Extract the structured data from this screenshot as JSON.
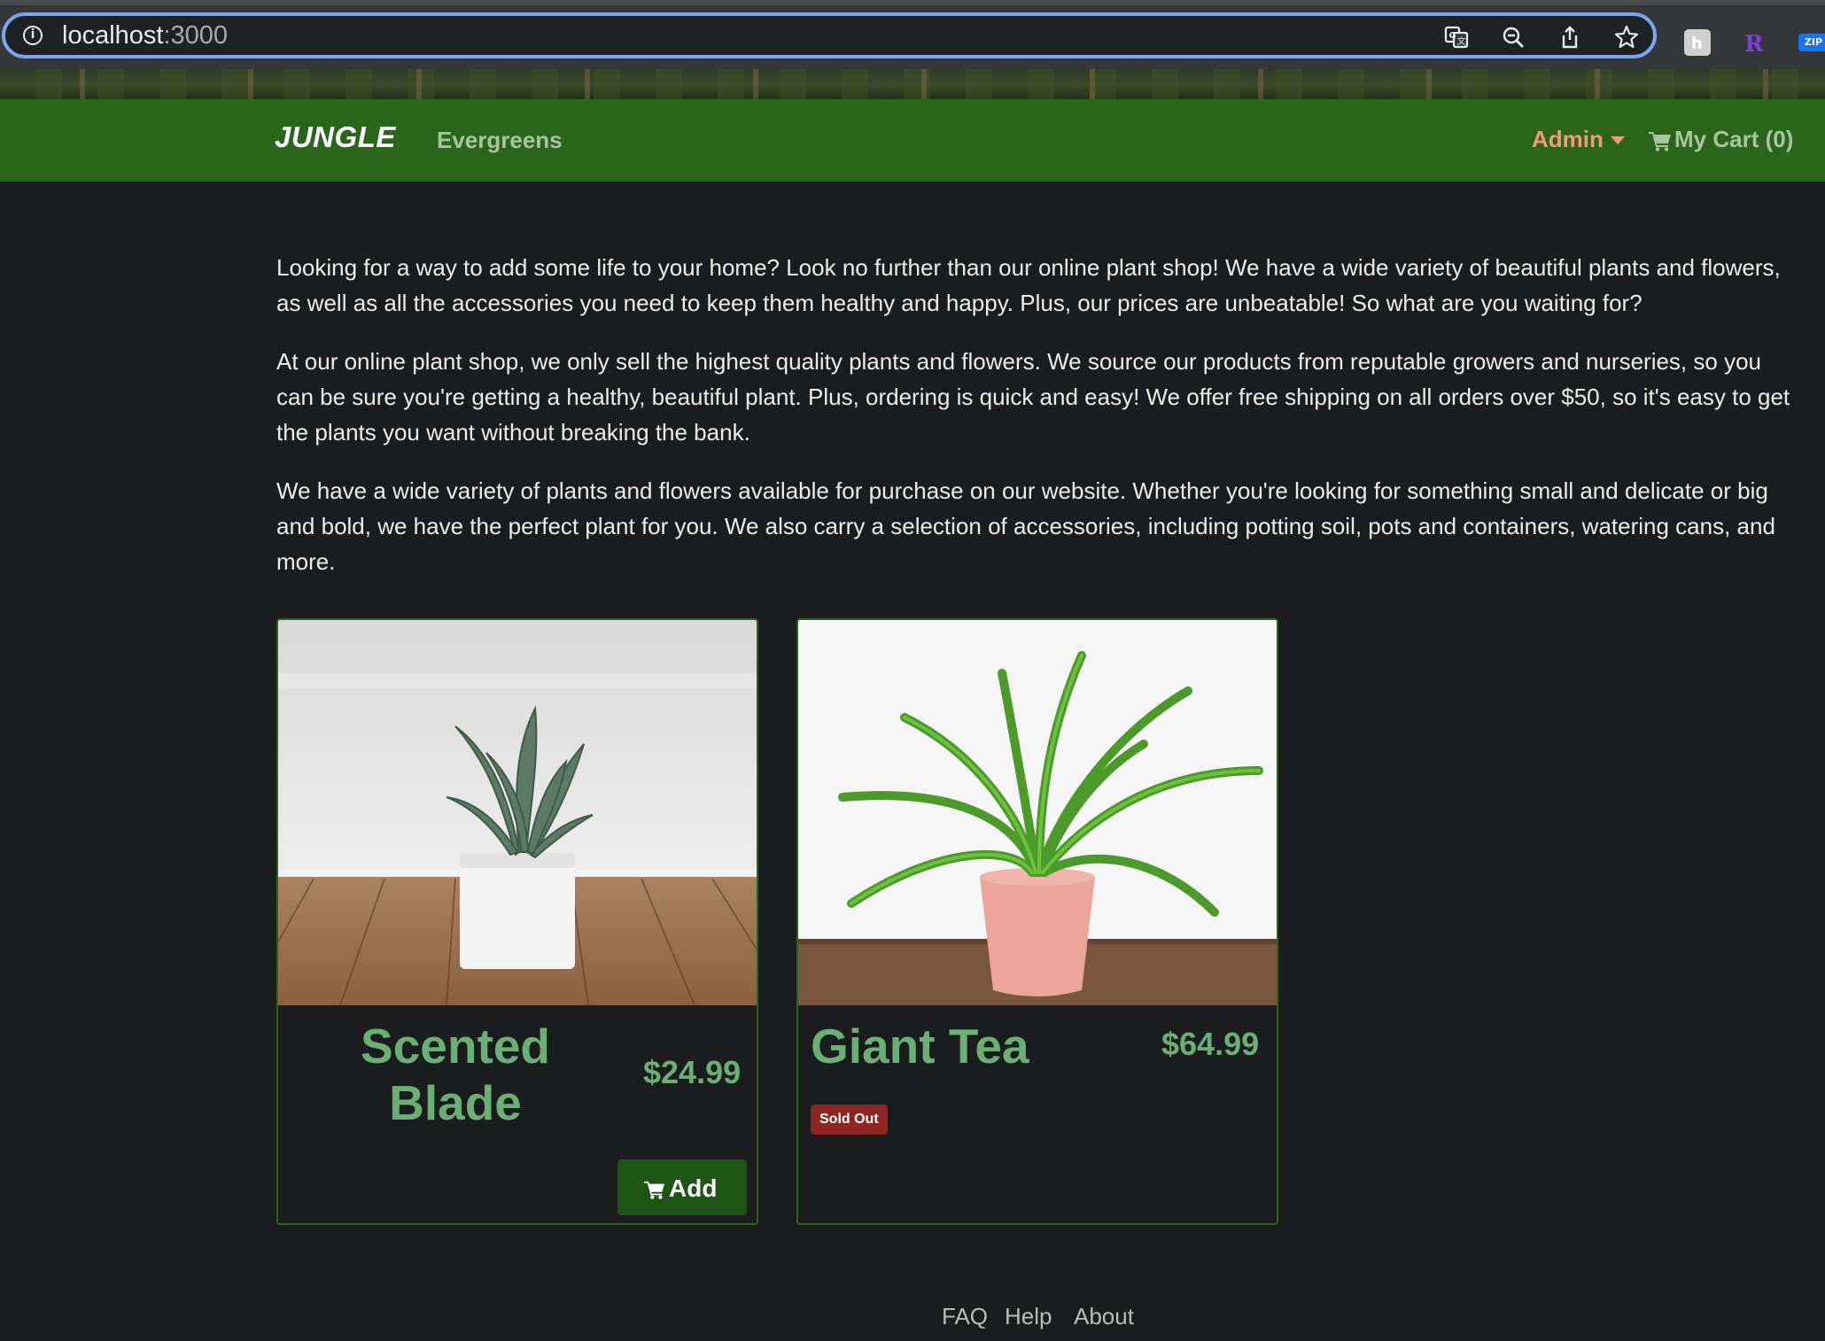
{
  "browser": {
    "url_host": "localhost",
    "url_port": ":3000",
    "info_icon": "info-icon",
    "omnibox_icons": [
      "translate-icon",
      "zoom-out-icon",
      "share-icon",
      "bookmark-star-icon"
    ],
    "extensions": [
      "hoppscotch-extension-icon",
      "r-extension-icon"
    ],
    "zip_extension_label": "ZIP"
  },
  "nav": {
    "brand": "JUNGLE",
    "category_link": "Evergreens",
    "admin_label": "Admin",
    "cart_label": "My Cart (0)"
  },
  "intro": {
    "paragraphs": [
      "Looking for a way to add some life to your home? Look no further than our online plant shop! We have a wide variety of beautiful plants and flowers, as well as all the accessories you need to keep them healthy and happy. Plus, our prices are unbeatable! So what are you waiting for?",
      "At our online plant shop, we only sell the highest quality plants and flowers. We source our products from reputable growers and nurseries, so you can be sure you're getting a healthy, beautiful plant. Plus, ordering is quick and easy! We offer free shipping on all orders over $50, so it's easy to get the plants you want without breaking the bank.",
      "We have a wide variety of plants and flowers available for purchase on our website. Whether you're looking for something small and delicate or big and bold, we have the perfect plant for you. We also carry a selection of accessories, including potting soil, pots and containers, watering cans, and more."
    ]
  },
  "products": [
    {
      "name": "Scented Blade",
      "price": "$24.99",
      "action_label": "Add"
    },
    {
      "name": "Giant Tea",
      "price": "$64.99",
      "badge": "Sold Out"
    }
  ],
  "footer": {
    "links": [
      "FAQ",
      "Help",
      "About"
    ]
  },
  "colors": {
    "navbar_bg": "#2a651b",
    "page_bg": "#1a1c1d",
    "product_green": "#6ab074",
    "admin_link": "#ee9a7e",
    "soldout_badge": "#8e2520",
    "add_button": "#1e5416"
  }
}
